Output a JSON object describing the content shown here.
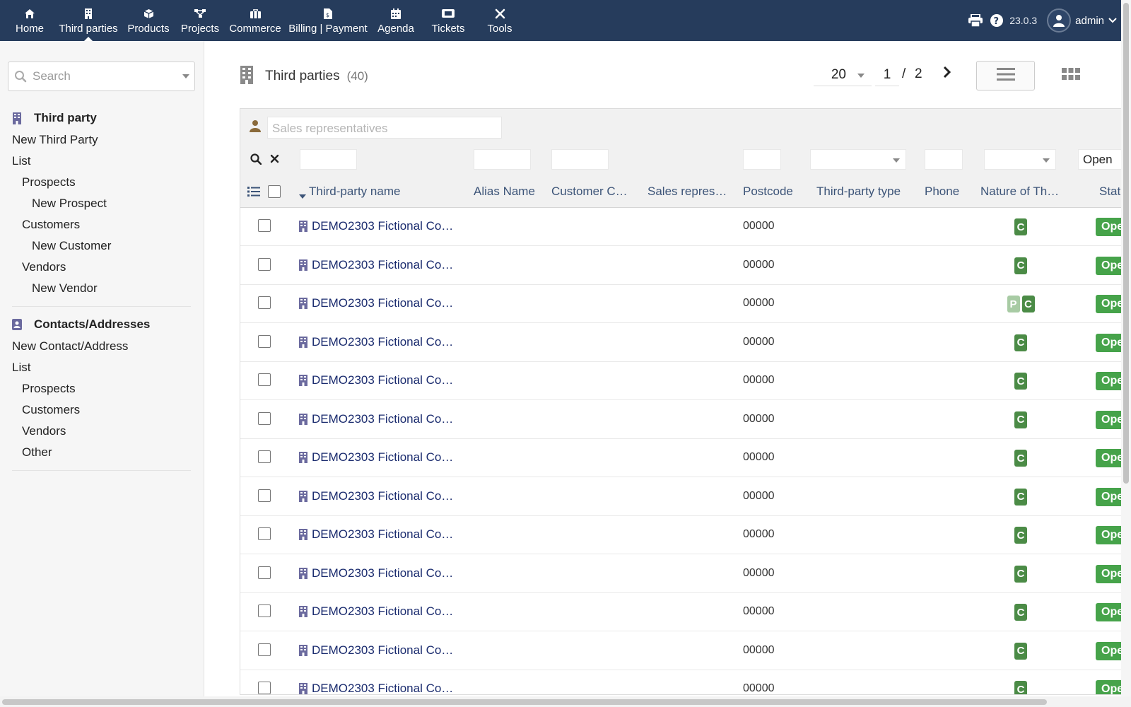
{
  "nav": {
    "items": [
      {
        "label": "Home",
        "icon": "home-icon"
      },
      {
        "label": "Third parties",
        "icon": "building-icon"
      },
      {
        "label": "Products",
        "icon": "cube-icon"
      },
      {
        "label": "Projects",
        "icon": "project-icon"
      },
      {
        "label": "Commerce",
        "icon": "suitcase-icon"
      },
      {
        "label": "Billing | Payment",
        "icon": "invoice-icon"
      },
      {
        "label": "Agenda",
        "icon": "calendar-icon"
      },
      {
        "label": "Tickets",
        "icon": "ticket-icon"
      },
      {
        "label": "Tools",
        "icon": "tools-icon"
      }
    ],
    "active": "Third parties",
    "version": "23.0.3",
    "user": "admin"
  },
  "sidebar": {
    "search_placeholder": "Search",
    "section1": {
      "title": "Third party",
      "links": [
        {
          "label": "New Third Party",
          "level": 1
        },
        {
          "label": "List",
          "level": 1
        },
        {
          "label": "Prospects",
          "level": 2
        },
        {
          "label": "New Prospect",
          "level": 3
        },
        {
          "label": "Customers",
          "level": 2
        },
        {
          "label": "New Customer",
          "level": 3
        },
        {
          "label": "Vendors",
          "level": 2
        },
        {
          "label": "New Vendor",
          "level": 3
        }
      ]
    },
    "section2": {
      "title": "Contacts/Addresses",
      "links": [
        {
          "label": "New Contact/Address",
          "level": 1
        },
        {
          "label": "List",
          "level": 1
        },
        {
          "label": "Prospects",
          "level": 2
        },
        {
          "label": "Customers",
          "level": 2
        },
        {
          "label": "Vendors",
          "level": 2
        },
        {
          "label": "Other",
          "level": 2
        }
      ]
    }
  },
  "main": {
    "title": "Third parties",
    "count": "(40)",
    "limit": "20",
    "page": "1",
    "page_sep": "/",
    "page_total": "2",
    "salesrep_placeholder": "Sales representatives",
    "status_filter": "Open",
    "columns": [
      "Third-party name",
      "Alias Name",
      "Customer C…",
      "Sales repres…",
      "Postcode",
      "Third-party type",
      "Phone",
      "Nature of Th…",
      "Stat"
    ]
  },
  "rows": [
    {
      "name": "DEMO2303 Fictional Co…",
      "postcode": "00000",
      "nature": [
        "C"
      ],
      "status": "Open"
    },
    {
      "name": "DEMO2303 Fictional Co…",
      "postcode": "00000",
      "nature": [
        "C"
      ],
      "status": "Open"
    },
    {
      "name": "DEMO2303 Fictional Co…",
      "postcode": "00000",
      "nature": [
        "P",
        "C"
      ],
      "status": "Open"
    },
    {
      "name": "DEMO2303 Fictional Co…",
      "postcode": "00000",
      "nature": [
        "C"
      ],
      "status": "Open"
    },
    {
      "name": "DEMO2303 Fictional Co…",
      "postcode": "00000",
      "nature": [
        "C"
      ],
      "status": "Open"
    },
    {
      "name": "DEMO2303 Fictional Co…",
      "postcode": "00000",
      "nature": [
        "C"
      ],
      "status": "Open"
    },
    {
      "name": "DEMO2303 Fictional Co…",
      "postcode": "00000",
      "nature": [
        "C"
      ],
      "status": "Open"
    },
    {
      "name": "DEMO2303 Fictional Co…",
      "postcode": "00000",
      "nature": [
        "C"
      ],
      "status": "Open"
    },
    {
      "name": "DEMO2303 Fictional Co…",
      "postcode": "00000",
      "nature": [
        "C"
      ],
      "status": "Open"
    },
    {
      "name": "DEMO2303 Fictional Co…",
      "postcode": "00000",
      "nature": [
        "C"
      ],
      "status": "Open"
    },
    {
      "name": "DEMO2303 Fictional Co…",
      "postcode": "00000",
      "nature": [
        "C"
      ],
      "status": "Open"
    },
    {
      "name": "DEMO2303 Fictional Co…",
      "postcode": "00000",
      "nature": [
        "C"
      ],
      "status": "Open"
    },
    {
      "name": "DEMO2303 Fictional Co…",
      "postcode": "00000",
      "nature": [
        "C"
      ],
      "status": "Open"
    }
  ],
  "colors": {
    "topbar": "#263c5c",
    "link": "#1a2b6e",
    "badge_customer": "#4b8b46",
    "badge_prospect": "#a8cba4",
    "status_open": "#46a34a"
  }
}
